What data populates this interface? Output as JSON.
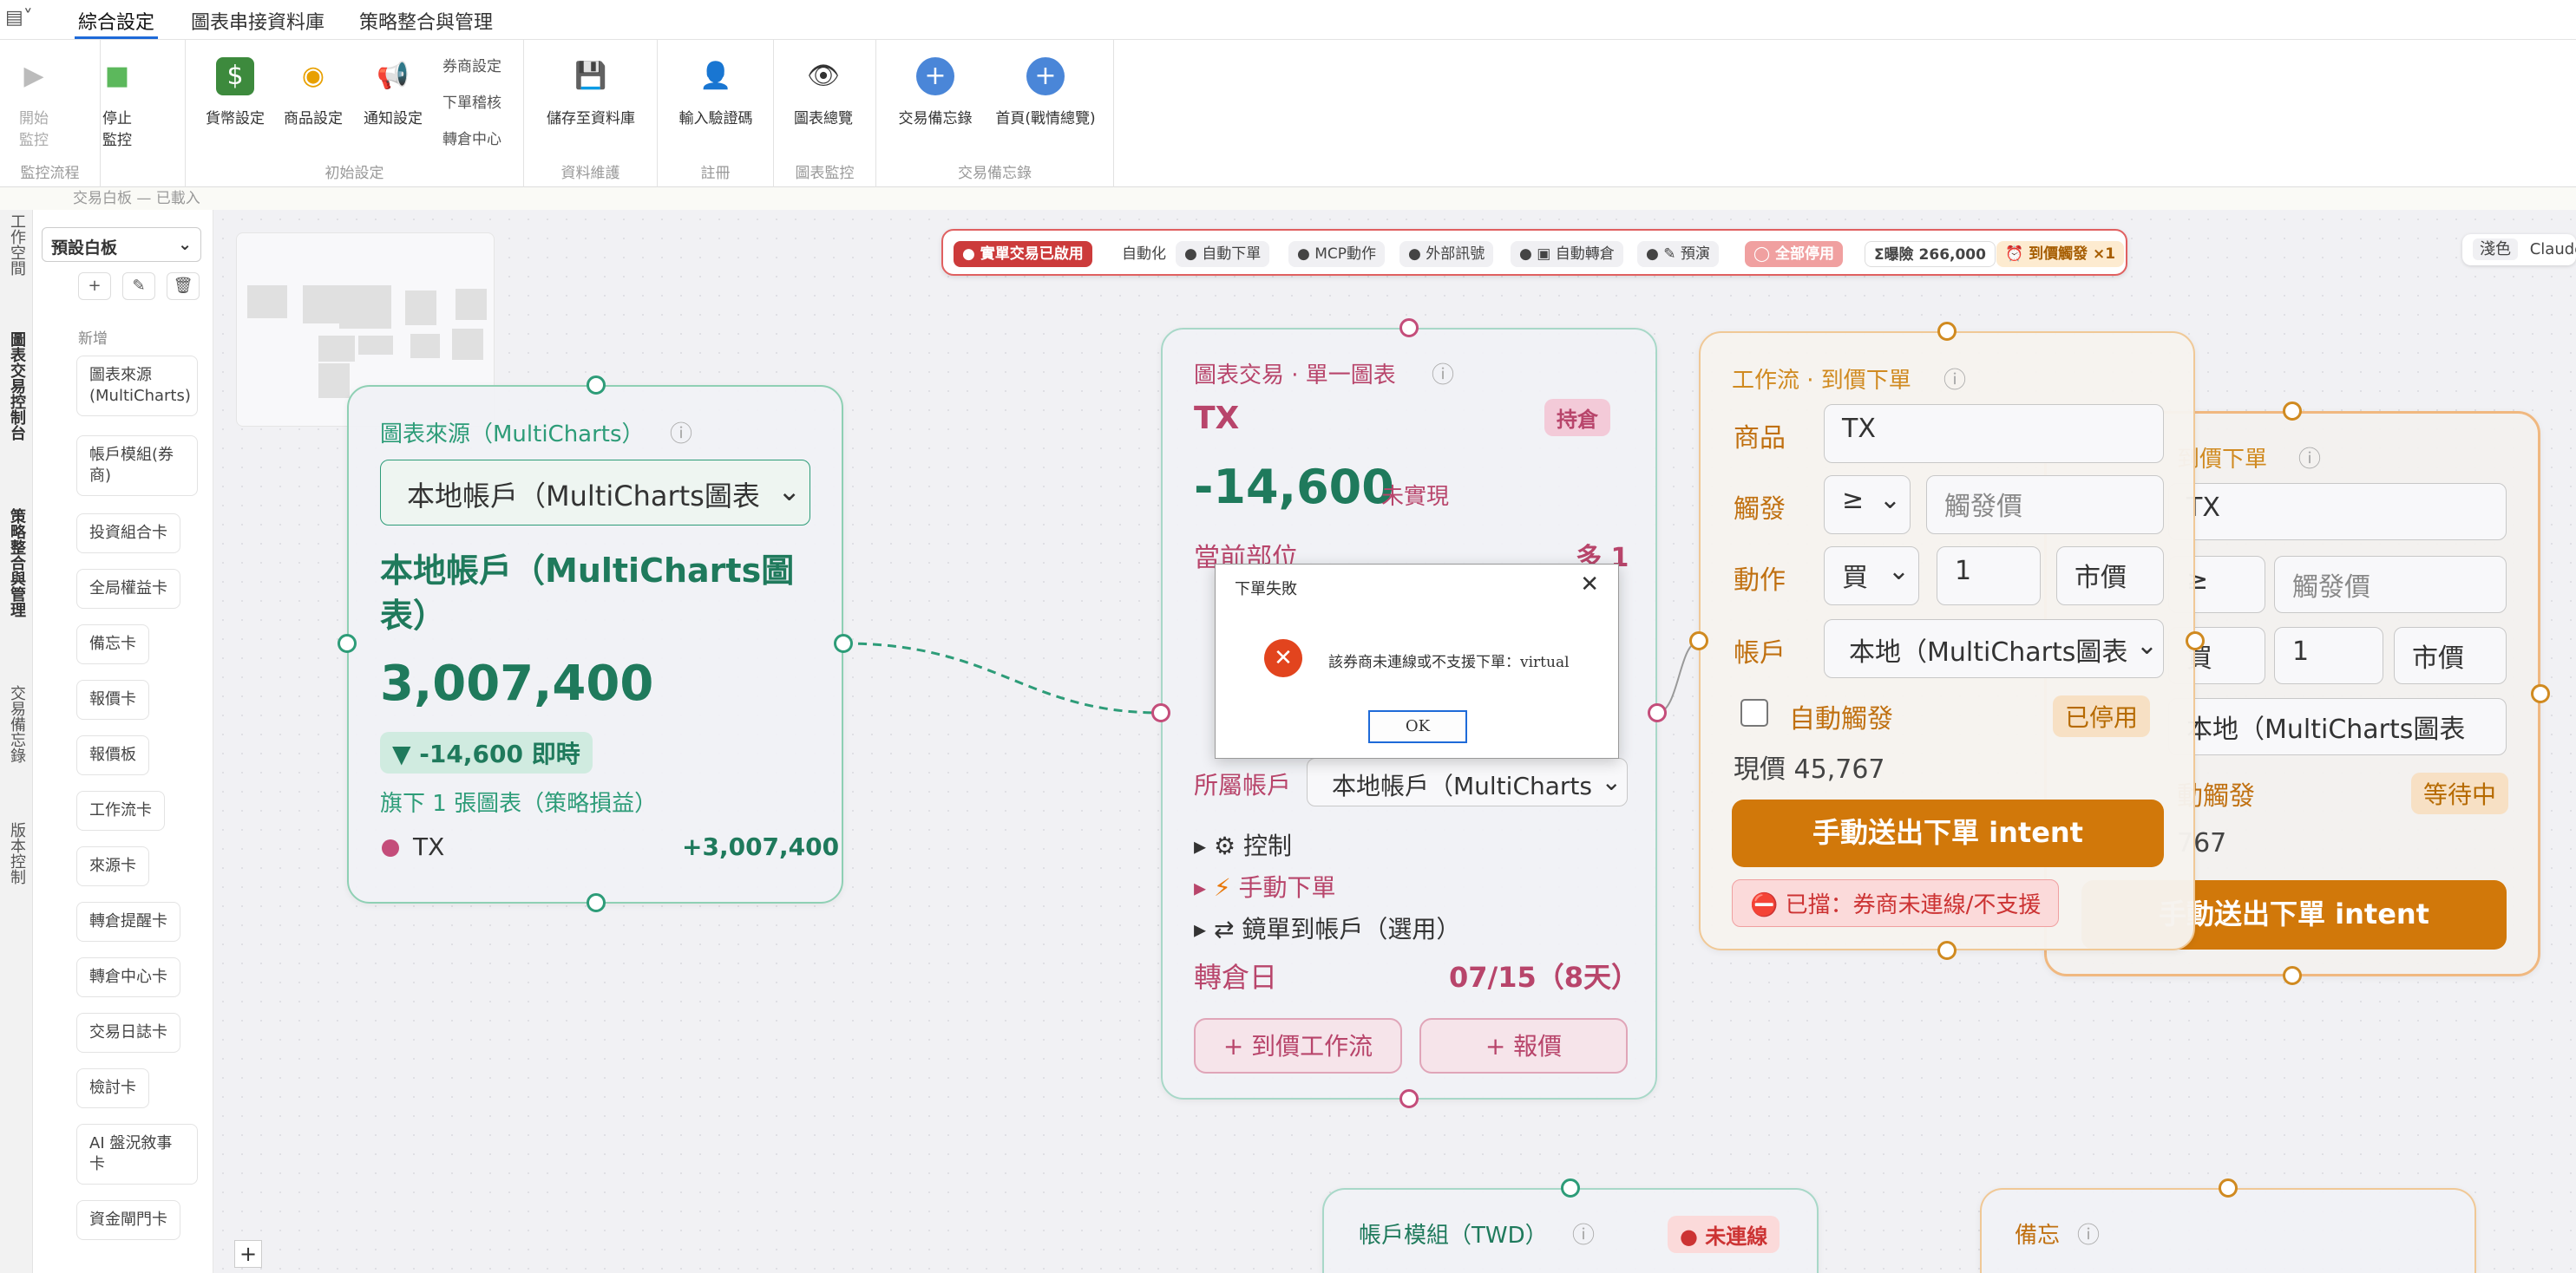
{
  "tabs": [
    "綜合設定",
    "圖表串接資料庫",
    "策略整合與管理"
  ],
  "ribbon": {
    "groups": [
      "監控流程",
      "初始設定",
      "資料維護",
      "註冊",
      "圖表監控",
      "交易備忘錄"
    ],
    "buttons": [
      "開始監控",
      "停止監控",
      "貨幣設定",
      "商品設定",
      "通知設定",
      "儲存至資料庫",
      "輸入驗證碼",
      "圖表總覽",
      "交易備忘錄",
      "首頁(戰情總覽)"
    ],
    "small": [
      "券商設定",
      "下單稽核",
      "轉倉中心"
    ]
  },
  "status": "交易白板 — 已載入",
  "rail": [
    "工作空間",
    "圖表交易控制台",
    "策略整合與管理",
    "交易備忘錄",
    "版本控制"
  ],
  "panel": {
    "select": "預設白板",
    "new_label": "新增",
    "items": [
      "圖表來源 (MultiCharts)",
      "帳戶模組(券商)",
      "投資組合卡",
      "全局權益卡",
      "備忘卡",
      "報價卡",
      "報價板",
      "工作流卡",
      "來源卡",
      "轉倉提醒卡",
      "轉倉中心卡",
      "交易日誌卡",
      "檢討卡",
      "AI 盤況敘事卡",
      "資金閘門卡"
    ]
  },
  "toolbar": {
    "live": "實單交易已啟用",
    "auto": "自動化",
    "items": [
      "自動下單",
      "MCP動作",
      "外部訊號",
      "自動轉倉",
      "預演"
    ],
    "all_off": "全部停用",
    "exposure": "Σ曝險 266,000",
    "trigger": "到價觸發 ×1"
  },
  "theme": {
    "label": "淺色",
    "model": "Claude"
  },
  "source_card": {
    "title": "圖表來源（MultiCharts）",
    "select": "本地帳戶（MultiCharts圖表",
    "name": "本地帳戶（MultiCharts圖表）",
    "value": "3,007,400",
    "delta": "▼ -14,600 即時",
    "sub": "旗下 1 張圖表（策略損益）",
    "row_sym": "TX",
    "row_val": "+3,007,400"
  },
  "chart_card": {
    "title": "圖表交易 · 單一圖表",
    "symbol": "TX",
    "badge": "持倉",
    "pnl": "-14,600",
    "pnl_label": "未實現",
    "pos_label": "當前部位",
    "pos_value": "多 1",
    "acct_label": "所屬帳戶",
    "acct_value": "本地帳戶（MultiCharts",
    "control": "控制",
    "manual": "手動下單",
    "mirror": "鏡單到帳戶（選用）",
    "roll_label": "轉倉日",
    "roll_value": "07/15（8天）",
    "btn1": "+ 到價工作流",
    "btn2": "+ 報價"
  },
  "workflow_card": {
    "title": "工作流 · 到價下單",
    "sym_label": "商品",
    "sym": "TX",
    "trig_label": "觸發",
    "op": "≥",
    "trig_ph": "觸發價",
    "act_label": "動作",
    "act": "買",
    "qty": "1",
    "type": "市價",
    "acct_label": "帳戶",
    "acct": "本地（MultiCharts圖表",
    "auto": "自動觸發",
    "auto_state": "已停用",
    "price": "現價 45,767",
    "send": "手動送出下單 intent",
    "blocked": "已擋：券商未連線/不支援"
  },
  "ghost_card": {
    "title": "到價下單",
    "sym": "TX",
    "op": "≥",
    "trig_ph": "觸發價",
    "act": "買",
    "qty": "1",
    "type": "市價",
    "acct": "本地（MultiCharts圖表",
    "auto": "動觸發",
    "auto_state": "等待中",
    "price": "767",
    "send": "手動送出下單 intent"
  },
  "account_card": {
    "title": "帳戶模組（TWD）",
    "state": "未連線"
  },
  "memo_card": {
    "title": "備忘"
  },
  "dialog": {
    "title": "下單失敗",
    "message": "該券商未連線或不支援下單：virtual",
    "ok": "OK"
  }
}
